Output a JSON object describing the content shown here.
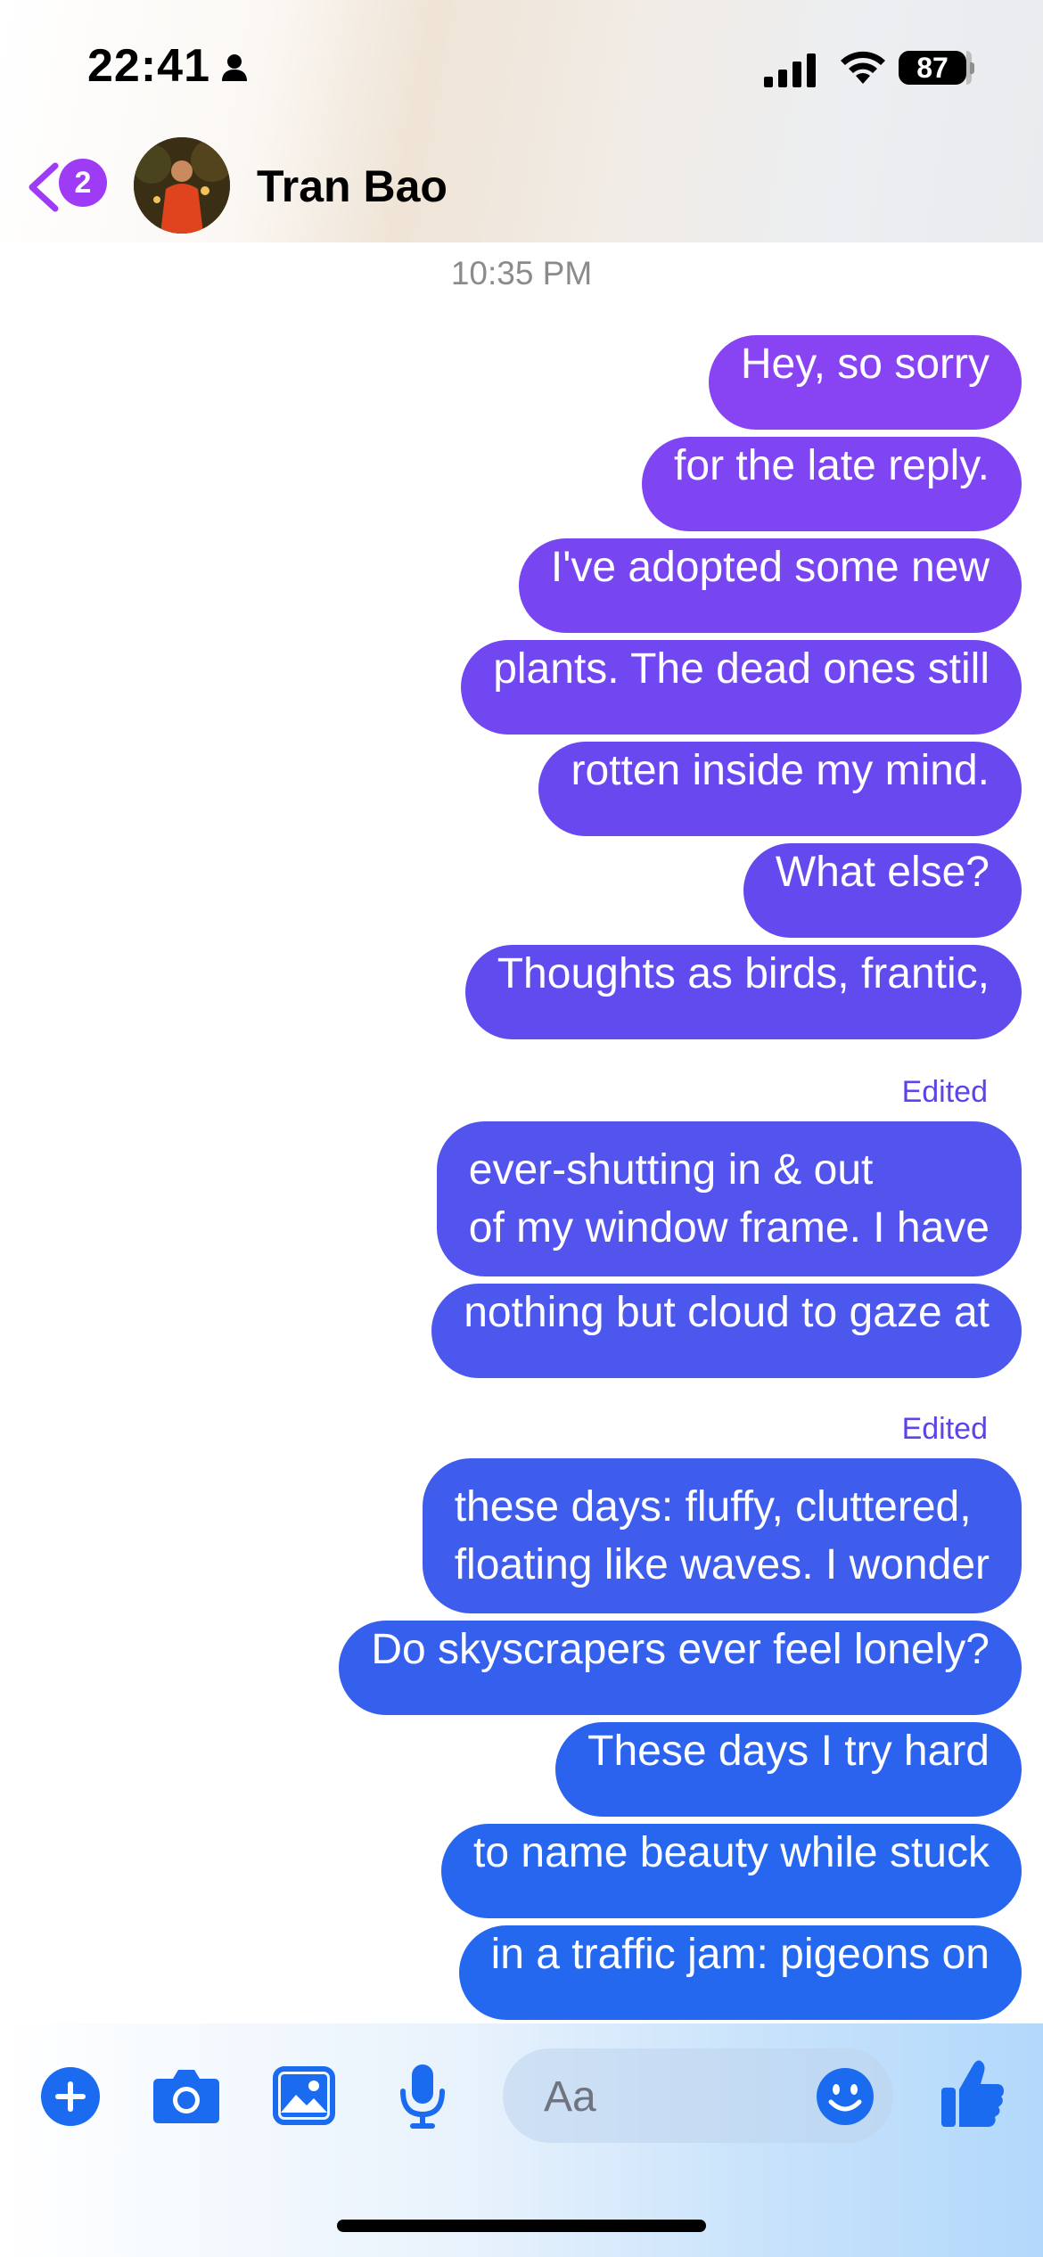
{
  "status_bar": {
    "time": "22:41",
    "battery": "87",
    "icons": [
      "person-icon",
      "signal-bars-icon",
      "wifi-icon",
      "battery-icon"
    ]
  },
  "header": {
    "unread_count": "2",
    "contact_name": "Tran Bao",
    "icons": [
      "back-chevron-icon",
      "avatar"
    ],
    "accent_color": "#9d3bf5"
  },
  "conversation": {
    "timestamp": "10:35 PM",
    "edited_label": "Edited",
    "messages": [
      {
        "lines": [
          "Hey, so sorry"
        ],
        "color": "#8844f3"
      },
      {
        "lines": [
          "for the late reply."
        ],
        "color": "#7f45f2"
      },
      {
        "lines": [
          "I've adopted some new"
        ],
        "color": "#7846f1"
      },
      {
        "lines": [
          "plants. The dead ones still"
        ],
        "color": "#7047f0"
      },
      {
        "lines": [
          "rotten inside my mind."
        ],
        "color": "#6a48f0"
      },
      {
        "lines": [
          "What else?"
        ],
        "color": "#6449ef"
      },
      {
        "lines": [
          "Thoughts as birds, frantic,"
        ],
        "color": "#5f4bee"
      },
      {
        "lines": [
          "ever-shutting in & out",
          "of my window frame. I have"
        ],
        "color": "#5353ed",
        "edited": true
      },
      {
        "lines": [
          "nothing but cloud to gaze at"
        ],
        "color": "#4c58ed"
      },
      {
        "lines": [
          "these days: fluffy, cluttered,",
          "floating like waves. I wonder"
        ],
        "color": "#3f5ded",
        "edited": true
      },
      {
        "lines": [
          "Do skyscrapers ever feel lonely?"
        ],
        "color": "#3560ed"
      },
      {
        "lines": [
          "These days I try hard"
        ],
        "color": "#2c63ee"
      },
      {
        "lines": [
          "to name beauty while stuck"
        ],
        "color": "#2766ef"
      },
      {
        "lines": [
          "in  a traffic jam: pigeons on"
        ],
        "color": "#2468f0"
      }
    ]
  },
  "composer": {
    "placeholder": "Aa",
    "icons": [
      "add-icon",
      "camera-icon",
      "photo-icon",
      "microphone-icon",
      "emoji-icon",
      "thumbs-up-icon"
    ],
    "accent_color": "#1a6bf0"
  }
}
